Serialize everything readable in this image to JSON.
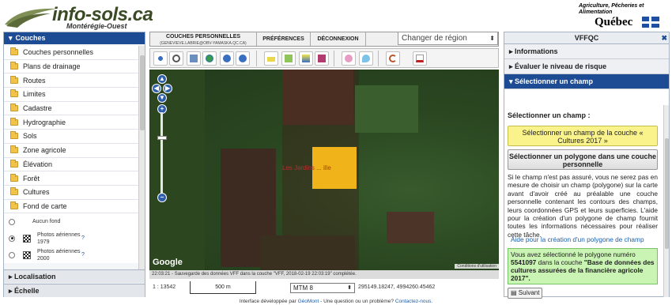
{
  "header": {
    "logo_title": "info-sols.ca",
    "logo_subtitle": "Montérégie-Ouest",
    "gov_line": "Agriculture, Pêcheries et Alimentation",
    "gov_name": "Québec"
  },
  "left_panel": {
    "title": "Couches",
    "layers": [
      "Couches personnelles",
      "Plans de drainage",
      "Routes",
      "Limites",
      "Cadastre",
      "Hydrographie",
      "Sols",
      "Zone agricole",
      "Élévation",
      "Forêt",
      "Cultures",
      "Fond de carte"
    ],
    "basemaps": [
      {
        "label": "Aucun fond",
        "selected": false
      },
      {
        "label": "Photos aériennes 1979",
        "selected": true
      },
      {
        "label": "Photos aériennes 2000",
        "selected": false
      }
    ],
    "localisation_label": "Localisation",
    "echelle_label": "Échelle"
  },
  "nav": {
    "couches_label": "COUCHES PERSONNELLES",
    "couches_sub": "(GENEVIEVE.LABRIE@OBV-YAMASKA.QC.CA)",
    "preferences_label": "PRÉFÉRENCES",
    "deconnexion_label": "DÉCONNEXION",
    "region_select": "Changer de région"
  },
  "map": {
    "parcel_label": "Les Jardins ... ille",
    "google_logo": "Google",
    "attribution": "Conditions d'utilisation",
    "status_text": "22:03:21 - Sauvegarde des données VFF dans la couche \"VFF, 2018-02-19 22:03:19\" complétée.",
    "scale_ratio": "1 : 13542",
    "scale_bar": "500 m",
    "projection": "MTM 8",
    "coordinates": "295149.18247, 4994260.45462"
  },
  "footer": {
    "text": "Interface développée par",
    "geomont": "GéoMont",
    "question": " - Une question ou un problème?",
    "contact": "Contactez-nous."
  },
  "right_panel": {
    "title": "VFFQC",
    "sections": [
      "Informations",
      "Évaluer le niveau de risque",
      "Sélectionner un champ"
    ],
    "prompt": "Sélectionner un champ :",
    "btn_select_field": "Sélectionner un champ de la couche « Cultures 2017 »",
    "btn_select_poly": "Sélectionner un polygone dans une couche personnelle",
    "info_text": "Si le champ n'est pas assuré, vous ne serez pas en mesure de choisir un champ (polygone) sur la carte avant d'avoir créé au préalable une couche personnelle contenant les contours des champs, leurs coordonnées GPS et leurs superficies. L'aide pour la création d'un polygone de champ fournit toutes les informations nécessaires pour réaliser cette tâche.",
    "help_link": "Aide pour la création d'un polygone de champ",
    "selected_prefix": "Vous avez sélectionné le polygone numéro",
    "selected_id": "5541097",
    "selected_mid": "dans la couche",
    "selected_layer": "\"Base de données des cultures assurées de la financière agricole 2017\".",
    "next_button": "Suivant"
  },
  "colors": {
    "header_blue": "#1d4b94",
    "parcel": "#f0b31a",
    "selected_green": "#c9f4b3",
    "select_yellow": "#faf38b"
  }
}
